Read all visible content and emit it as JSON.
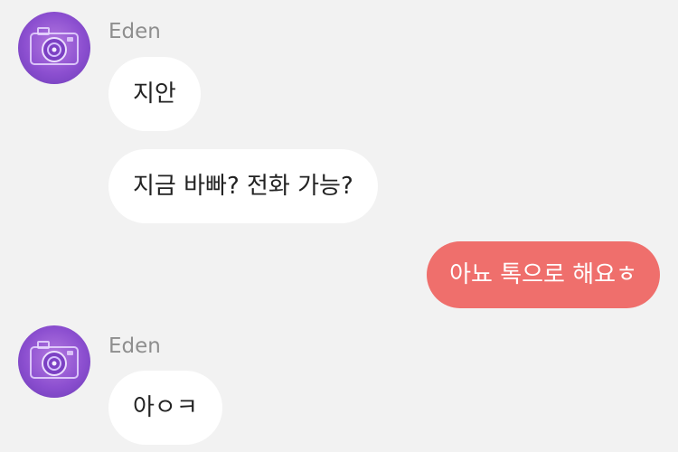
{
  "colors": {
    "background": "#f2f2f2",
    "incoming_bubble": "#ffffff",
    "outgoing_bubble": "#ef6f6c",
    "sender_name": "#8e8e8e",
    "avatar_purple": "#8c4fd0"
  },
  "messages": [
    {
      "direction": "incoming",
      "sender": "Eden",
      "avatar_icon": "camera-icon",
      "bubbles": [
        "지안",
        "지금 바빠? 전화 가능?"
      ]
    },
    {
      "direction": "outgoing",
      "bubbles": [
        "아뇨 톡으로 해요ㅎ"
      ]
    },
    {
      "direction": "incoming",
      "sender": "Eden",
      "avatar_icon": "camera-icon",
      "bubbles": [
        "아ㅇㅋ"
      ]
    }
  ]
}
